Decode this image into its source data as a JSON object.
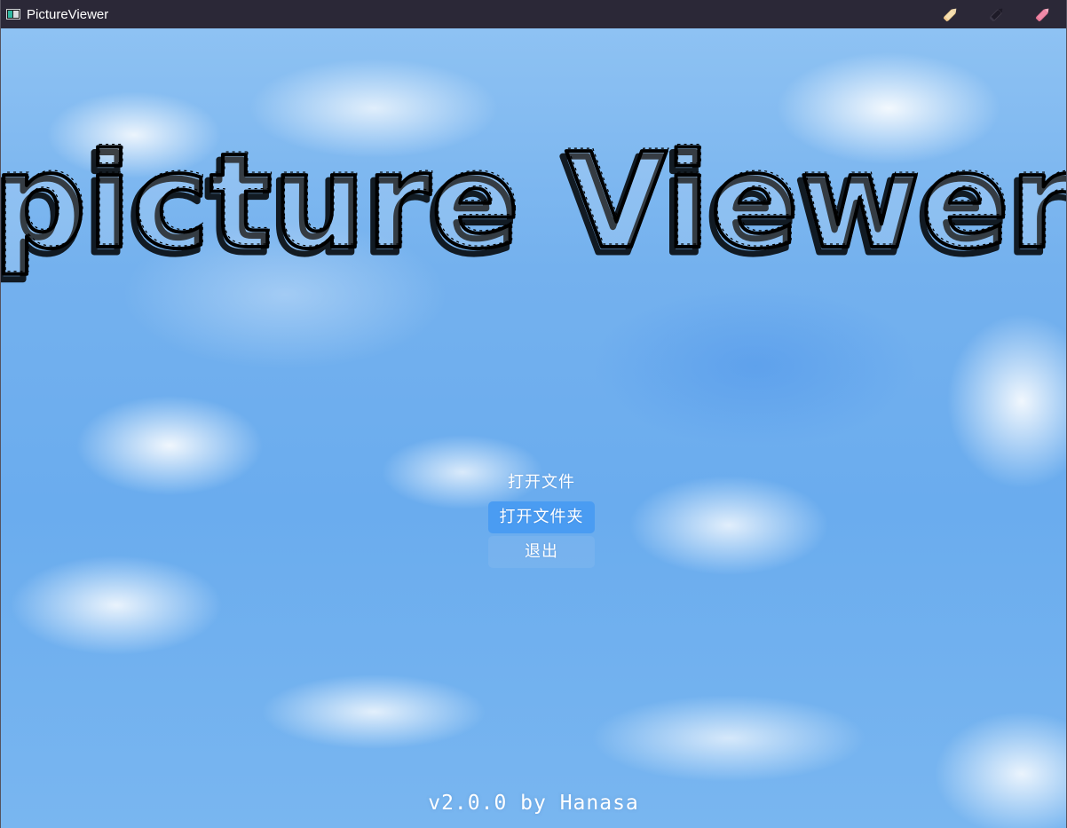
{
  "window": {
    "title": "PictureViewer",
    "controls": [
      {
        "name": "minimize",
        "icon": "pencil-icon",
        "color": "#f5deb0"
      },
      {
        "name": "maximize",
        "icon": "pencil-icon",
        "color": "#2b2837"
      },
      {
        "name": "close",
        "icon": "pencil-icon",
        "color": "#f08aa8"
      }
    ]
  },
  "main": {
    "title": "picture Viewer"
  },
  "menu": {
    "items": [
      {
        "label": "打开文件",
        "state": "normal"
      },
      {
        "label": "打开文件夹",
        "state": "active"
      },
      {
        "label": "退出",
        "state": "subtle"
      }
    ]
  },
  "footer": {
    "version_text": "v2.0.0 by Hanasa"
  },
  "theme": {
    "titlebar_bg": "#2b2837",
    "accent": "#4a9cf2",
    "sky": "#6aacee"
  }
}
